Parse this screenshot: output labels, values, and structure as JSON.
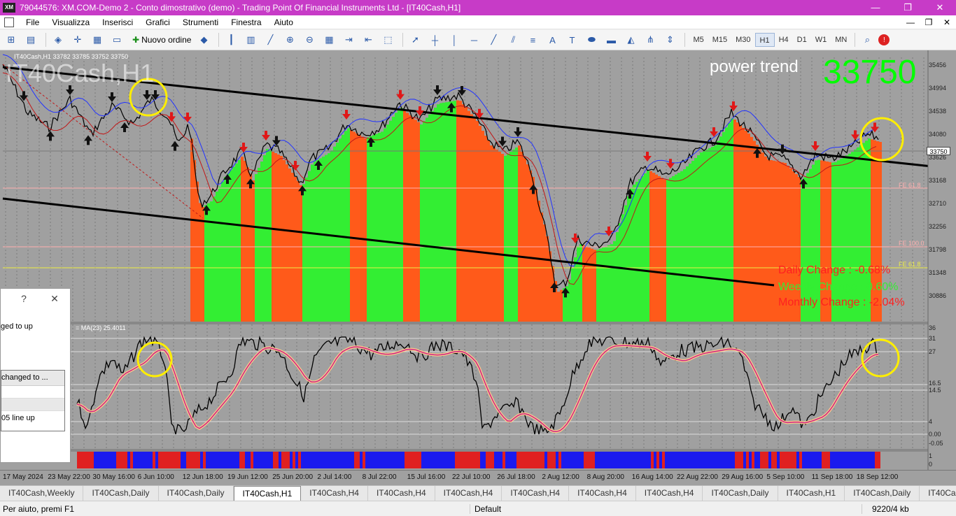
{
  "window": {
    "title": "79044576: XM.COM-Demo 2 - Conto dimostrativo (demo) - Trading Point Of Financial Instruments Ltd - [IT40Cash,H1]",
    "app_icon": "XM",
    "minimize": "—",
    "restore": "❐",
    "close": "✕"
  },
  "menu": {
    "items": [
      "File",
      "Visualizza",
      "Inserisci",
      "Grafici",
      "Strumenti",
      "Finestra",
      "Aiuto"
    ],
    "right": [
      "—",
      "❐",
      "✕"
    ]
  },
  "toolbar": {
    "new_order": "Nuovo ordine",
    "timeframes": [
      "M5",
      "M15",
      "M30",
      "H1",
      "H4",
      "D1",
      "W1",
      "MN"
    ],
    "active_timeframe": "H1"
  },
  "chart": {
    "symbol_watermark": "IT40Cash,H1",
    "ohlc": "IT40Cash,H1  33782 33785 33752 33750",
    "power_trend_label": "power trend",
    "power_trend_price": "33750",
    "current_price": "33750",
    "price_axis": [
      "35456",
      "34994",
      "34538",
      "34080",
      "33626",
      "33168",
      "32710",
      "32256",
      "31798",
      "31348",
      "30886"
    ],
    "fe_labels": [
      "FE 61.8",
      "FE 100.0",
      "FE 61.8"
    ],
    "stats": {
      "daily": "Daily Change : -0.68%",
      "weekly": "Weekly Change : 0.60%",
      "monthly": "Monthly Change : -2.04%"
    },
    "indicator_label": "= MA(23) 25.4011",
    "indicator_axis": [
      "36",
      "31",
      "27",
      "16.5",
      "14.5",
      "4",
      "0.00",
      "-0.05"
    ],
    "bottom_axis": [
      "1",
      "0"
    ],
    "dates": [
      "17 May 2024",
      "23 May 22:00",
      "30 May 16:00",
      "6 Jun 10:00",
      "12 Jun 18:00",
      "19 Jun 12:00",
      "25 Jun 20:00",
      "2 Jul 14:00",
      "8 Jul 22:00",
      "15 Jul 16:00",
      "22 Jul 10:00",
      "26 Jul 18:00",
      "2 Aug 12:00",
      "8 Aug 20:00",
      "16 Aug 14:00",
      "22 Aug 22:00",
      "29 Aug 16:00",
      "5 Sep 10:00",
      "11 Sep 18:00",
      "18 Sep 12:00"
    ],
    "colors": {
      "background": "#a0a0a0",
      "bull_histogram": "#33ee33",
      "bear_histogram": "#ff5a1a",
      "highlight_circle": "#ffee00",
      "ma_line": "#ff8800",
      "trend_line": "#000000"
    }
  },
  "dialog": {
    "help": "?",
    "close": "✕",
    "row1": "ged to up",
    "row2": "changed to ...",
    "row3": "05 line up"
  },
  "tabs": [
    "IT40Cash,Weekly",
    "IT40Cash,Daily",
    "IT40Cash,Daily",
    "IT40Cash,H1",
    "IT40Cash,H4",
    "IT40Cash,H4",
    "IT40Cash,H4",
    "IT40Cash,H4",
    "IT40Cash,H4",
    "IT40Cash,H4",
    "IT40Cash,Daily",
    "IT40Cash,H1",
    "IT40Cash,Daily",
    "IT40Cash,Daily"
  ],
  "active_tab_index": 3,
  "status": {
    "help": "Per aiuto, premi F1",
    "profile": "Default",
    "traffic": "9220/4 kb"
  }
}
